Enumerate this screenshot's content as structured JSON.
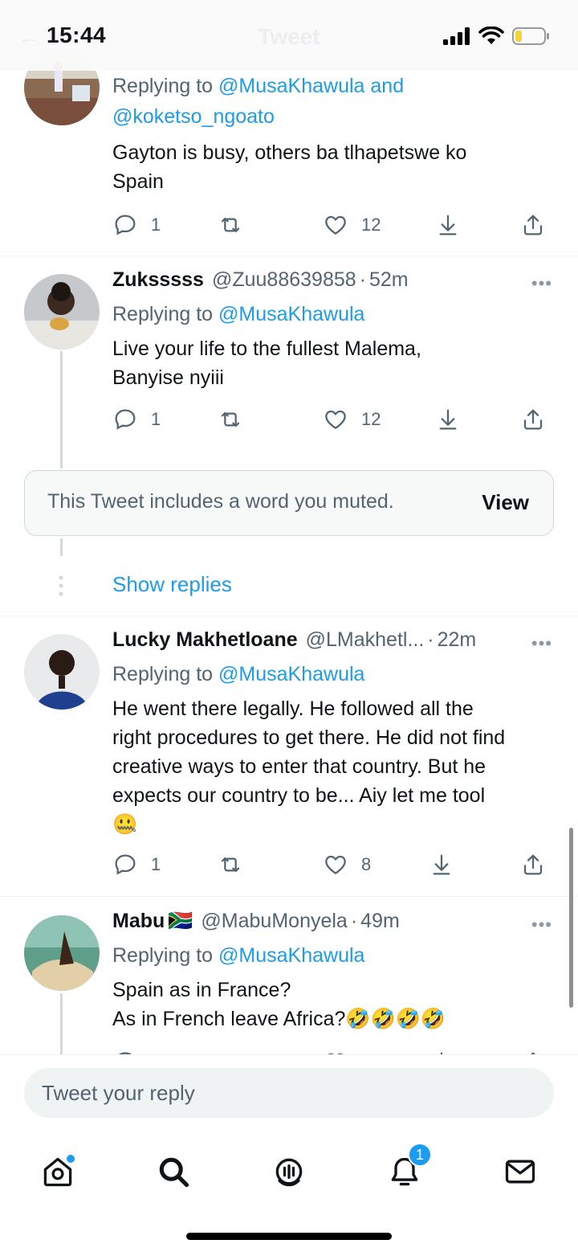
{
  "status_bar": {
    "time": "15:44",
    "title": "Tweet"
  },
  "tweets": [
    {
      "replying_label": "Replying to",
      "mentions": [
        "@MusaKhawula",
        "@koketso_ngoato"
      ],
      "joiner": "and",
      "text": [
        "Gayton is busy, others ba tlhapetswe ko",
        "Spain"
      ],
      "replies": "1",
      "likes": "12"
    },
    {
      "name": "Zuksssss",
      "handle": "@Zuu88639858",
      "time": "52m",
      "replying_label": "Replying to",
      "mention": "@MusaKhawula",
      "text": [
        "Live your life to the fullest Malema,",
        "Banyise nyiii"
      ],
      "replies": "1",
      "likes": "12"
    },
    {
      "name": "Lucky Makhetloane",
      "handle": "@LMakhetl...",
      "time": "22m",
      "replying_label": "Replying to",
      "mention": "@MusaKhawula",
      "text": [
        "He went there legally. He followed all the",
        "right procedures to get there. He did not find",
        "creative ways to enter that country. But he",
        "expects our country to be... Aiy let me tool",
        "🤐"
      ],
      "replies": "1",
      "likes": "8"
    },
    {
      "name": "Mabu",
      "flag": "🇿🇦",
      "handle": "@MabuMonyela",
      "time": "49m",
      "replying_label": "Replying to",
      "mention": "@MusaKhawula",
      "text": [
        "Spain as in France?",
        "As in French leave Africa?🤣🤣🤣🤣"
      ]
    }
  ],
  "muted": {
    "text": "This Tweet includes a word you muted.",
    "view_label": "View"
  },
  "show_replies": "Show replies",
  "reply_box": {
    "placeholder": "Tweet your reply"
  },
  "tab_bar": {
    "notifications_count": "1",
    "icons": [
      "home-icon",
      "search-icon",
      "spaces-icon",
      "notifications-icon",
      "messages-icon"
    ]
  },
  "colors": {
    "accent": "#1d9bf0",
    "text": "#0f1419",
    "secondary": "#536471",
    "muted_bg": "#f7f9f9",
    "scrollbar": "#8e8e93"
  }
}
